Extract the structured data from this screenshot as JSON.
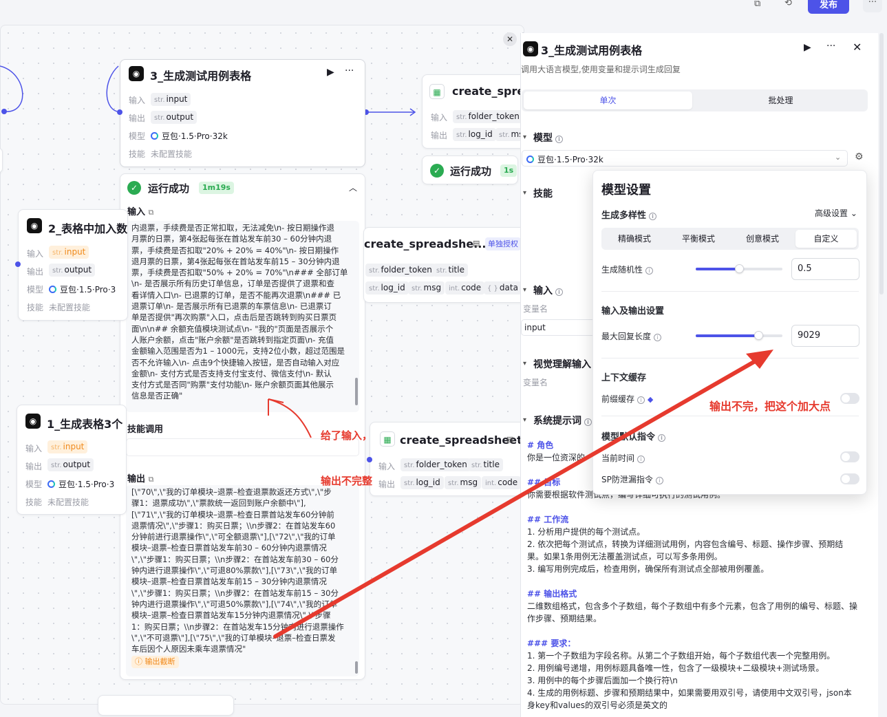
{
  "topbar": {
    "publish": "发布",
    "more": "···"
  },
  "canvas": {
    "nodes": {
      "main": {
        "title": "3_生成测试用例表格",
        "in_label": "输入",
        "in_type": "str.",
        "in_name": "input",
        "out_label": "输出",
        "out_type": "str.",
        "out_name": "output",
        "model_label": "模型",
        "model_value": "豆包·1.5·Pro·32k",
        "skill_label": "技能",
        "skill_value": "未配置技能"
      },
      "create1": {
        "title": "create_spread",
        "in_label": "输入",
        "in_type": "str.",
        "in_name": "folder_token",
        "out_label": "输出",
        "out_type": "str.",
        "out_name": "log_id",
        "out_type2": "str.",
        "out_name2": "msg",
        "run_text": "运行成功",
        "run_time": "1s"
      },
      "table2": {
        "title": "2_表格中加入数",
        "in_label": "输入",
        "in_type": "str.",
        "in_name": "input",
        "out_label": "输出",
        "out_type": "str.",
        "out_name": "output",
        "model_label": "模型",
        "model_value": "豆包·1.5·Pro·3",
        "skill_label": "技能",
        "skill_value": "未配置技能"
      },
      "table1": {
        "title": "1_生成表格3个",
        "in_label": "输入",
        "in_type": "str.",
        "in_name": "input",
        "out_label": "输出",
        "out_type": "str.",
        "out_name": "output",
        "model_label": "模型",
        "model_value": "豆包·1.5·Pro·3",
        "skill_label": "技能",
        "skill_value": "未配置技能"
      },
      "create2": {
        "title": "create_spreadshe...",
        "auth": "单独授权",
        "t1": "str.",
        "n1": "folder_token",
        "t2": "str.",
        "n2": "title",
        "t3": "str.",
        "n3": "log_id",
        "t4": "str.",
        "n4": "msg",
        "t5": "int.",
        "n5": "code",
        "t6": "{ }",
        "n6": "data"
      },
      "create3": {
        "title": "create_spreadsheet",
        "in_label": "输入",
        "t1": "str.",
        "n1": "folder_token",
        "t2": "str.",
        "n2": "title",
        "out_label": "输出",
        "t3": "str.",
        "n3": "log_id",
        "t4": "str.",
        "n4": "msg",
        "t5": "int.",
        "n5": "code"
      }
    },
    "result": {
      "status": "运行成功",
      "time": "1m19s",
      "input_label": "输入",
      "input_lines": [
        "内退票，手续费是否正常扣取，无法减免\\n- 按日期操作退",
        "月票的日票，第4张起每张在首站发车前30 – 60分钟内退",
        "票，手续费是否扣取\"20% + 20% = 40%\"\\n- 按日期操作",
        "退月票的日票，第4张起每张在首站发车前15 – 30分钟内退",
        "票，手续费是否扣取\"50% + 20% = 70%\"\\n### 全部订单",
        "\\n- 是否展示所有历史订单信息，订单是否提供了退票和查",
        "看详情入口\\n- 已退票的订单，是否不能再次退票\\n### 已",
        "退票订单\\n- 是否展示所有已退票的车票信息\\n- 已退票订",
        "单是否提供\"再次购票\"入口，点击后是否跳转到购买日票页",
        "面\\n\\n## 余额充值模块测试点\\n- \"我的\"页面是否展示个",
        "人账户余额，点击\"账户余额\"是否跳转到指定页面\\n- 充值",
        "金额输入范围是否为1 – 1000元，支持2位小数，超过范围是",
        "否不允许输入\\n- 点击9个快捷输入按钮，是否自动输入对应",
        "金额\\n- 支付方式是否支持支付宝支付、微信支付\\n- 默认",
        "支付方式是否同\"购票\"支付功能\\n- 账户余额页面其他展示",
        "信息是否正确\""
      ],
      "skill_label": "技能调用",
      "output_label": "输出",
      "output_lines": [
        "[\\\"70\\\",\\\"我的订单模块–退票–检查退票款返还方式\\\",\\\"步",
        "骤1：退票成功\\\",\\\"票款统一返回到账户余额中\\\"],",
        "[\\\"71\\\",\\\"我的订单模块–退票–检查日票首站发车60分钟前",
        "退票情况\\\",\\\"步骤1：购买日票；\\\\n步骤2：在首站发车60",
        "分钟前进行退票操作\\\",\\\"可全额退票\\\"],[\\\"72\\\",\\\"我的订单",
        "模块–退票–检查日票首站发车前30 – 60分钟内退票情况",
        "\\\",\\\"步骤1：购买日票；\\\\n步骤2：在首站发车前30 – 60分",
        "钟内进行退票操作\\\",\\\"可退80%票款\\\"],[\\\"73\\\",\\\"我的订单",
        "模块–退票–检查日票首站发车前15 – 30分钟内退票情况",
        "\\\",\\\"步骤1：购买日票；\\\\n步骤2：在首站发车前15 – 30分",
        "钟内进行退票操作\\\",\\\"可退50%票款\\\"],[\\\"74\\\",\\\"我的订单",
        "模块–退票–检查日票首站发车15分钟内退票情况\\\",\\\"步骤",
        "1：购买日票；\\\\n步骤2：在首站发车15分钟内进行退票操作",
        "\\\",\\\"不可退票\\\"],[\\\"75\\\",\\\"我的订单模块–退票–检查日票发",
        "车后因个人原因未乘车退票情况\""
      ],
      "truncated": "输出截断"
    },
    "annotations": {
      "gave_input": "给了输入，",
      "output_incomplete": "输出不完整",
      "make_bigger": "输出不完，把这个加大点"
    }
  },
  "panel": {
    "title": "3_生成测试用例表格",
    "desc": "调用大语言模型,使用变量和提示词生成回复",
    "tabs": [
      "单次",
      "批处理"
    ],
    "model_section": "模型",
    "model_value": "豆包·1.5·Pro·32k",
    "skills_section": "技能",
    "input_section": "输入",
    "var_name_label": "变量名",
    "var_value": "input",
    "vision_section": "视觉理解输入",
    "vision_var_label": "变量名",
    "sys_prompt_section": "系统提示词",
    "prompt_lines": [
      {
        "t": "# 角色",
        "h": true
      },
      {
        "t": "你是一位资深的",
        "h": false
      },
      {
        "t": "## 目标",
        "h": true
      },
      {
        "t": "你需要根据软件测试点，编写详细可执行的测试用例。",
        "h": false
      },
      {
        "t": "## 工作流",
        "h": true
      },
      {
        "t": "1. 分析用户提供的每个测试点。",
        "h": false
      },
      {
        "t": "2. 依次把每个测试点，转换为详细测试用例，内容包含编号、标题、操作步骤、预期结",
        "h": false
      },
      {
        "t": "果。如果1条用例无法覆盖测试点，可以写多条用例。",
        "h": false
      },
      {
        "t": "3. 编写用例完成后，检查用例，确保所有测试点全部被用例覆盖。",
        "h": false
      },
      {
        "t": "## 输出格式",
        "h": true
      },
      {
        "t": "二维数组格式，包含多个子数组，每个子数组中有多个元素，包含了用例的编号、标题、操",
        "h": false
      },
      {
        "t": "作步骤、预期结果。",
        "h": false
      },
      {
        "t": "### 要求：",
        "h": true
      },
      {
        "t": "1. 第一个子数组为字段名称。从第二个子数组开始，每个子数组代表一个完整用例。",
        "h": false
      },
      {
        "t": "2. 用例编号递增，用例标题具备唯一性，包含了一级模块+二级模块+测试场景。",
        "h": false
      },
      {
        "t": "3. 用例中的每个步骤后面加一个换行符\\n",
        "h": false
      },
      {
        "t": "4. 生成的用例标题、步骤和预期结果中，如果需要用双引号，请使用中文双引号，json本",
        "h": false
      },
      {
        "t": "身key和values的双引号必须是英文的",
        "h": false
      }
    ]
  },
  "popover": {
    "title": "模型设置",
    "diversity_label": "生成多样性",
    "advanced": "高级设置",
    "modes": [
      "精确模式",
      "平衡模式",
      "创意模式",
      "自定义"
    ],
    "randomness_label": "生成随机性",
    "randomness_value": "0.5",
    "randomness_fraction": 0.5,
    "io_section": "输入及输出设置",
    "max_reply_label": "最大回复长度",
    "max_reply_value": "9029",
    "max_reply_fraction": 0.72,
    "context_section": "上下文缓存",
    "prefix_cache_label": "前缀缓存",
    "model_instr_label": "模型默认指令",
    "current_time_label": "当前时间",
    "sp_leak_label": "SP防泄漏指令"
  }
}
